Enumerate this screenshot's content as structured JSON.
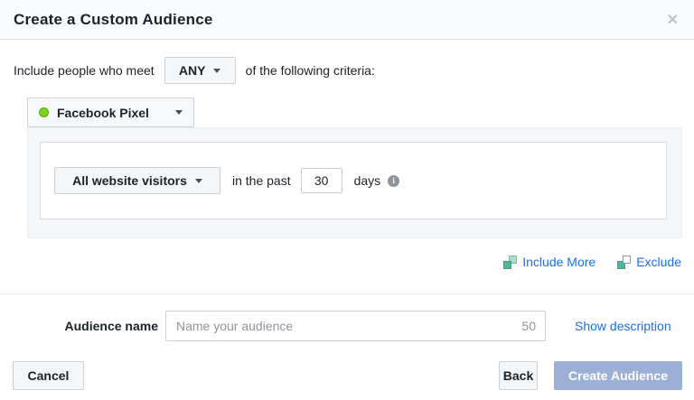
{
  "dialog": {
    "title": "Create a Custom Audience",
    "close_glyph": "✕"
  },
  "criteria": {
    "prefix": "Include people who meet",
    "match_value": "ANY",
    "suffix": "of the following criteria:",
    "source": {
      "label": "Facebook Pixel",
      "status_color": "#7ed321"
    },
    "rule": {
      "visitor_value": "All website visitors",
      "middle_text": "in the past",
      "days_value": "30",
      "days_label": "days",
      "info_glyph": "i"
    },
    "actions": {
      "include_more": "Include More",
      "exclude": "Exclude"
    }
  },
  "audience_name": {
    "label": "Audience name",
    "placeholder": "Name your audience",
    "char_count": "50",
    "show_description": "Show description"
  },
  "footer": {
    "cancel": "Cancel",
    "back": "Back",
    "create": "Create Audience"
  },
  "colors": {
    "link_blue": "#216fdb",
    "disabled_create_button": "#9cb0d5",
    "status_green": "#7ed321",
    "icon_teal": "#55b498",
    "panel_gray": "#f5f6f7"
  }
}
